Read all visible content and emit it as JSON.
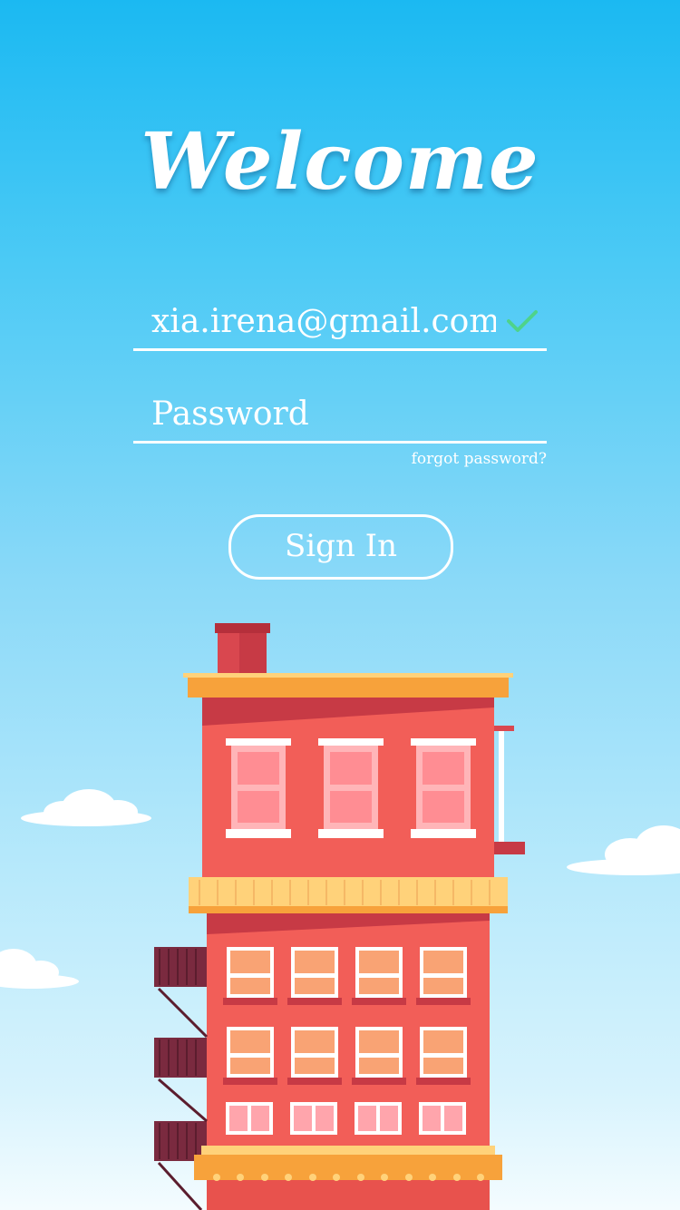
{
  "title": "Welcome",
  "login": {
    "email_value": "xia.irena@gmail.com",
    "password_placeholder": "Password",
    "forgot_label": "forgot password?",
    "signin_label": "Sign In"
  },
  "colors": {
    "sky_top": "#1bb9f2",
    "sky_bottom": "#f4fcff",
    "check_green": "#4ed38a",
    "building_red": "#f25e58",
    "roof_orange": "#f7a23b"
  },
  "icons": [
    "check-icon",
    "cloud-icon",
    "building-illustration"
  ]
}
